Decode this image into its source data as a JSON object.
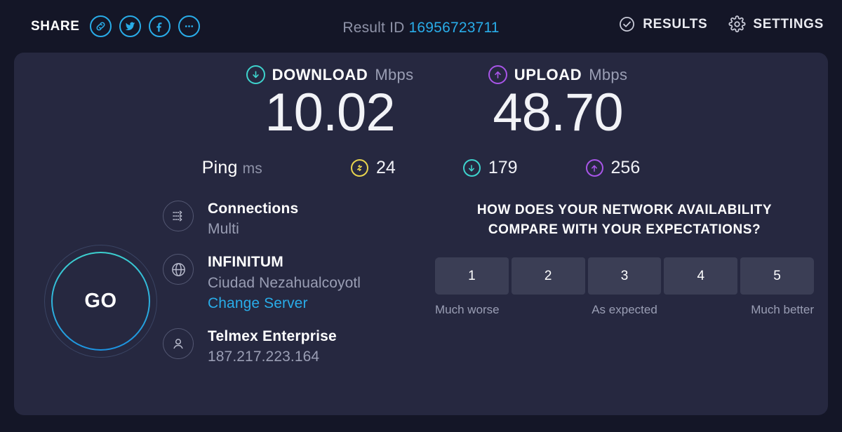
{
  "header": {
    "share_label": "SHARE",
    "share_icons": [
      {
        "name": "link-icon"
      },
      {
        "name": "twitter-icon"
      },
      {
        "name": "facebook-icon"
      },
      {
        "name": "more-options-icon"
      }
    ],
    "result_id_label": "Result ID",
    "result_id_value": "16956723711",
    "results_label": "RESULTS",
    "settings_label": "SETTINGS"
  },
  "speeds": {
    "download": {
      "title": "DOWNLOAD",
      "unit": "Mbps",
      "value": "10.02",
      "color": "#3ed3cd",
      "icon": "arrow-down-circle-icon"
    },
    "upload": {
      "title": "UPLOAD",
      "unit": "Mbps",
      "value": "48.70",
      "color": "#a855e8",
      "icon": "arrow-up-circle-icon"
    }
  },
  "ping": {
    "label": "Ping",
    "unit": "ms",
    "idle": {
      "value": "24",
      "color": "#e8d44d",
      "icon": "latency-idle-icon"
    },
    "download": {
      "value": "179",
      "color": "#3ed3cd",
      "icon": "latency-download-icon"
    },
    "upload": {
      "value": "256",
      "color": "#a855e8",
      "icon": "latency-upload-icon"
    }
  },
  "go_button": {
    "label": "GO"
  },
  "info": {
    "connections": {
      "icon": "connections-multi-icon",
      "title": "Connections",
      "subtitle": "Multi"
    },
    "server": {
      "icon": "globe-icon",
      "title": "INFINITUM",
      "subtitle": "Ciudad Nezahualcoyotl",
      "link": "Change Server"
    },
    "isp": {
      "icon": "user-icon",
      "title": "Telmex Enterprise",
      "subtitle": "187.217.223.164"
    }
  },
  "survey": {
    "question_line1": "HOW DOES YOUR NETWORK AVAILABILITY",
    "question_line2": "COMPARE WITH YOUR EXPECTATIONS?",
    "options": [
      "1",
      "2",
      "3",
      "4",
      "5"
    ],
    "scale_low": "Much worse",
    "scale_mid": "As expected",
    "scale_high": "Much better"
  },
  "theme": {
    "background": "#141627",
    "panel": "#262840",
    "accent_blue": "#29ace8",
    "teal": "#3ed3cd",
    "purple": "#a855e8",
    "yellow": "#e8d44d"
  }
}
